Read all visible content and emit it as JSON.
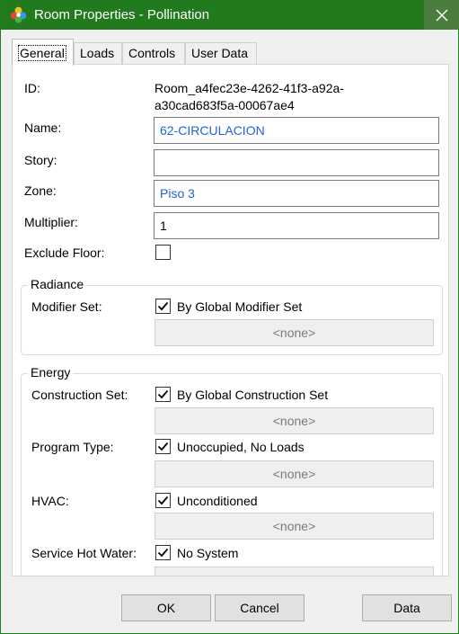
{
  "window": {
    "title": "Room Properties - Pollination"
  },
  "tabs": [
    {
      "label": "General"
    },
    {
      "label": "Loads"
    },
    {
      "label": "Controls"
    },
    {
      "label": "User Data"
    }
  ],
  "general": {
    "id_label": "ID:",
    "id_value_line1": "Room_a4fec23e-4262-41f3-a92a-",
    "id_value_line2": "a30cad683f5a-00067ae4",
    "name_label": "Name:",
    "name_value": "62-CIRCULACION",
    "story_label": "Story:",
    "story_value": "",
    "zone_label": "Zone:",
    "zone_value": "Piso 3",
    "multiplier_label": "Multiplier:",
    "multiplier_value": "1",
    "exclude_floor_label": "Exclude Floor:",
    "exclude_floor_checked": false
  },
  "radiance": {
    "title": "Radiance",
    "modifier_set_label": "Modifier Set:",
    "modifier_set_checkbox_label": "By Global Modifier Set",
    "modifier_set_checked": true,
    "modifier_set_button": "<none>"
  },
  "energy": {
    "title": "Energy",
    "construction_set_label": "Construction Set:",
    "construction_set_checkbox_label": "By Global Construction Set",
    "construction_set_button": "<none>",
    "program_type_label": "Program Type:",
    "program_type_checkbox_label": "Unoccupied, No Loads",
    "program_type_button": "<none>",
    "hvac_label": "HVAC:",
    "hvac_checkbox_label": "Unconditioned",
    "hvac_button": "<none>",
    "service_hot_water_label": "Service Hot Water:",
    "service_hot_water_checkbox_label": "No System"
  },
  "footer": {
    "ok_label": "OK",
    "cancel_label": "Cancel",
    "data_label": "Data"
  },
  "colors": {
    "titlebar": "#217a1e",
    "link_text": "#1f63d6"
  }
}
